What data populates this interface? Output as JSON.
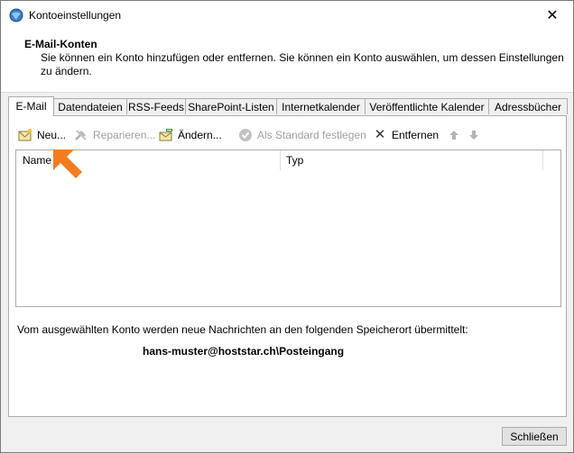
{
  "window": {
    "title": "Kontoeinstellungen",
    "close_glyph": "✕"
  },
  "header": {
    "title": "E-Mail-Konten",
    "description": "Sie können ein Konto hinzufügen oder entfernen. Sie können ein Konto auswählen, um dessen Einstellungen zu ändern."
  },
  "tabs": [
    {
      "label": "E-Mail",
      "active": true
    },
    {
      "label": "Datendateien"
    },
    {
      "label": "RSS-Feeds"
    },
    {
      "label": "SharePoint-Listen"
    },
    {
      "label": "Internetkalender"
    },
    {
      "label": "Veröffentlichte Kalender"
    },
    {
      "label": "Adressbücher"
    }
  ],
  "toolbar": {
    "new_label": "Neu...",
    "repair_label": "Reparieren...",
    "change_label": "Ändern...",
    "set_default_label": "Als Standard festlegen",
    "remove_label": "Entfernen",
    "remove_glyph": "✕",
    "up_icon": "arrow-up-icon",
    "down_icon": "arrow-down-icon"
  },
  "list": {
    "columns": [
      "Name",
      "Typ"
    ],
    "rows": []
  },
  "storage": {
    "label": "Vom ausgewählten Konto werden neue Nachrichten an den folgenden Speicherort übermittelt:",
    "location": "hans-muster@hoststar.ch\\Posteingang"
  },
  "footer": {
    "close_label": "Schließen"
  },
  "colors": {
    "accent_arrow": "#f47c20",
    "border": "#adadad",
    "disabled": "#a0a0a0"
  }
}
